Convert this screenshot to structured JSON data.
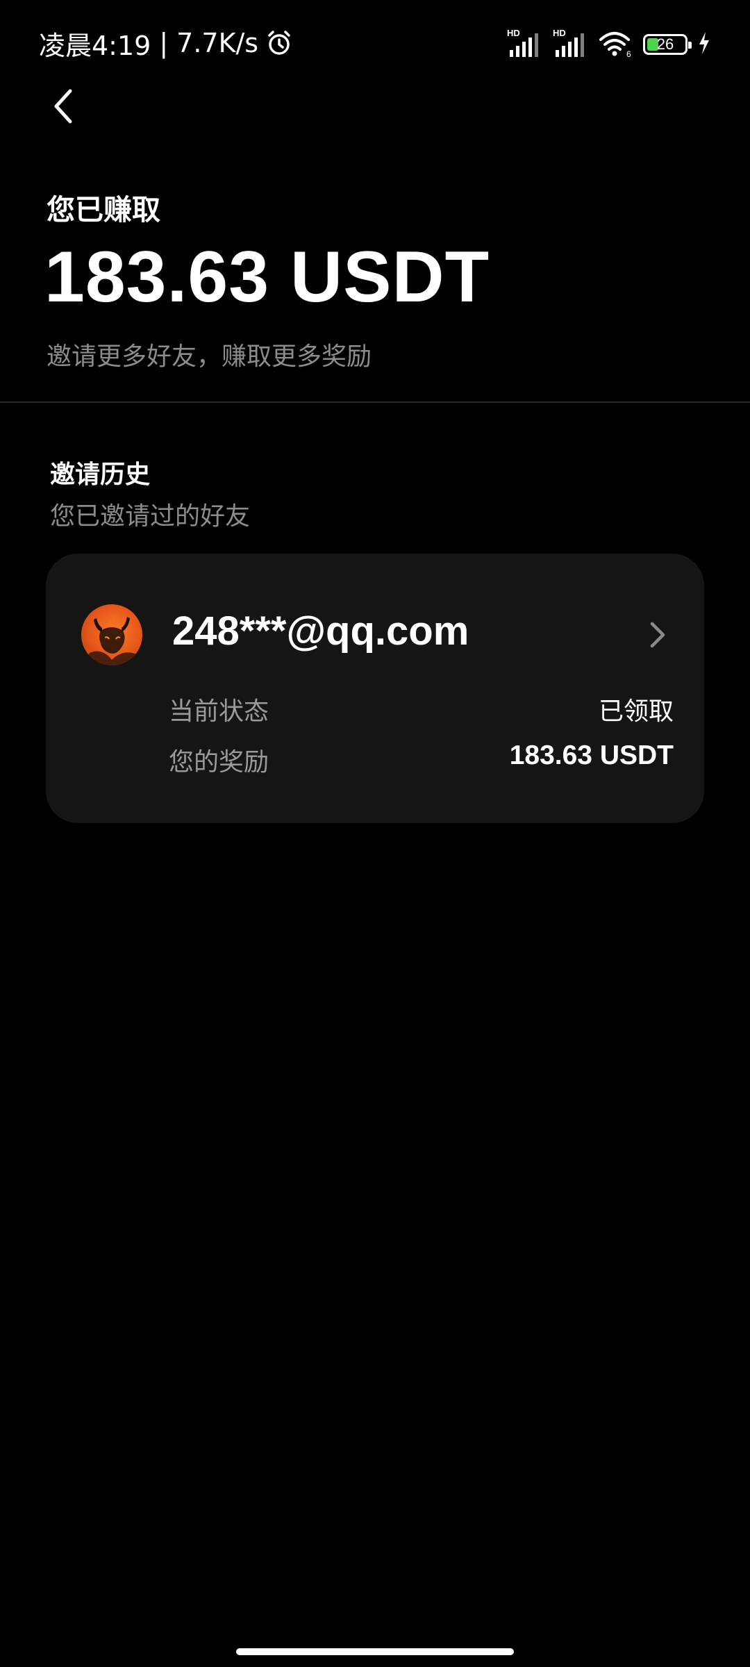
{
  "status_bar": {
    "time": "凌晨4:19",
    "separator": "|",
    "network_speed": "7.7K/s",
    "battery_level": "26",
    "icons": [
      "alarm-icon",
      "signal-hd-icon",
      "signal-hd-icon",
      "wifi-icon",
      "battery-icon",
      "charging-icon"
    ]
  },
  "header": {
    "back_icon": "chevron-left-icon"
  },
  "earnings": {
    "label": "您已赚取",
    "amount": "183.63 USDT",
    "subtitle": "邀请更多好友，赚取更多奖励"
  },
  "history": {
    "title": "邀请历史",
    "subtitle": "您已邀请过的好友",
    "items": [
      {
        "email": "248***@qq.com",
        "status_label": "当前状态",
        "status_value": "已领取",
        "reward_label": "您的奖励",
        "reward_value": "183.63 USDT"
      }
    ]
  },
  "colors": {
    "background": "#000000",
    "card": "#151515",
    "secondary_text": "#8c8c8c",
    "battery_fill": "#4fd34a",
    "avatar_accent": "#e4561a"
  }
}
